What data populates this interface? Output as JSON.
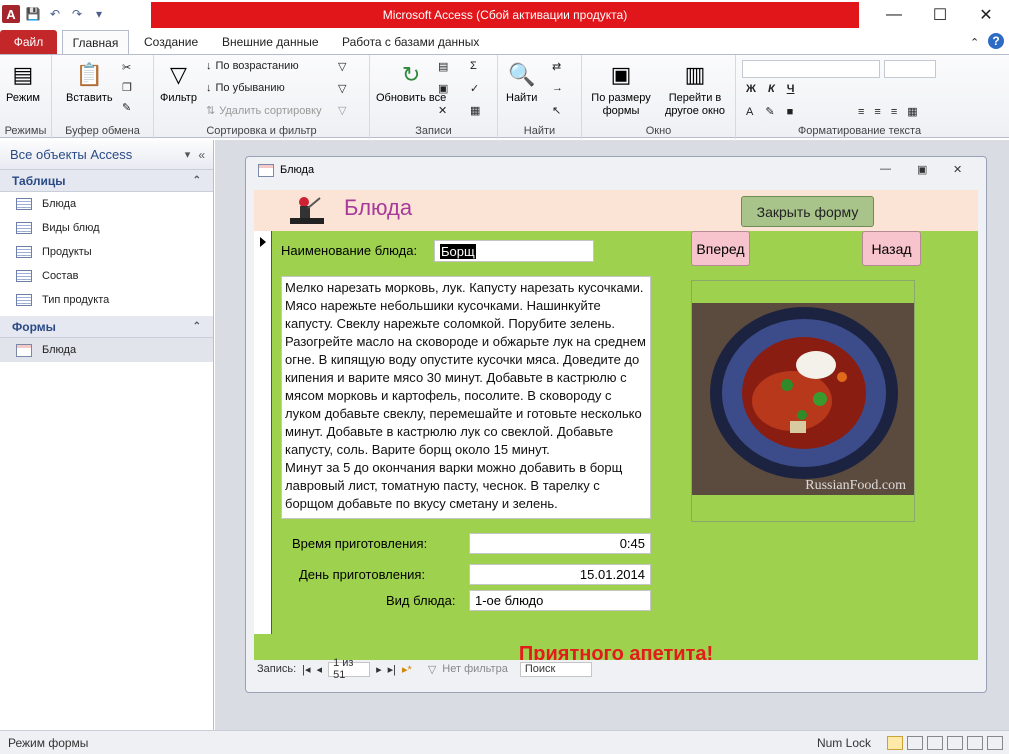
{
  "window": {
    "title": "Microsoft Access (Сбой активации продукта)"
  },
  "tabs": [
    "Файл",
    "Главная",
    "Создание",
    "Внешние данные",
    "Работа с базами данных"
  ],
  "ribbon": {
    "groups": [
      "Режимы",
      "Буфер обмена",
      "Сортировка и фильтр",
      "Записи",
      "Найти",
      "Окно",
      "Форматирование текста"
    ],
    "mode_label": "Режим",
    "paste_label": "Вставить",
    "filter_label": "Фильтр",
    "sort_asc": "По возрастанию",
    "sort_desc": "По убыванию",
    "sort_remove": "Удалить сортировку",
    "refresh_label": "Обновить все",
    "find_label": "Найти",
    "fit_label": "По размеру формы",
    "switch_label": "Перейти в другое окно"
  },
  "nav": {
    "header": "Все объекты Access",
    "tables_title": "Таблицы",
    "tables": [
      "Блюда",
      "Виды блюд",
      "Продукты",
      "Состав",
      "Тип продукта"
    ],
    "forms_title": "Формы",
    "forms": [
      "Блюда"
    ]
  },
  "form": {
    "window_title": "Блюда",
    "header_title": "Блюда",
    "close_button": "Закрыть форму",
    "next_button": "Вперед",
    "prev_button": "Назад",
    "name_label": "Наименование блюда:",
    "name_value": "Борщ",
    "recipe": "Мелко нарезать морковь, лук. Капусту нарезать кусочками. Мясо нарежьте небольшики кусочками. Нашинкуйте капусту. Свеклу нарежьте соломкой. Порубите зелень. Разогрейте масло на сковороде и обжарьте лук на среднем огне. В кипящую воду опустите кусочки мяса. Доведите до кипения и варите мясо 30 минут. Добавьте в кастрюлю с мясом морковь и картофель, посолите. В сковороду с луком добавьте свеклу, перемешайте и готовьте несколько минут. Добавьте в кастрюлю лук со свеклой. Добавьте капусту, соль. Варите борщ около 15 минут.\nМинут за 5 до окончания варки можно добавить в борщ лавровый лист, томатную пасту, чеснок. В тарелку с борщом добавьте по вкусу сметану и зелень.",
    "time_label": "Время приготовления:",
    "time_value": "0:45",
    "day_label": "День приготовления:",
    "day_value": "15.01.2014",
    "type_label": "Вид блюда:",
    "type_value": "1-ое блюдо",
    "greeting": "Приятного апетита!",
    "photo_caption": "RussianFood.com"
  },
  "record_nav": {
    "label": "Запись:",
    "position": "1 из 51",
    "filter": "Нет фильтра",
    "search": "Поиск"
  },
  "status": {
    "mode": "Режим формы",
    "numlock": "Num Lock"
  }
}
